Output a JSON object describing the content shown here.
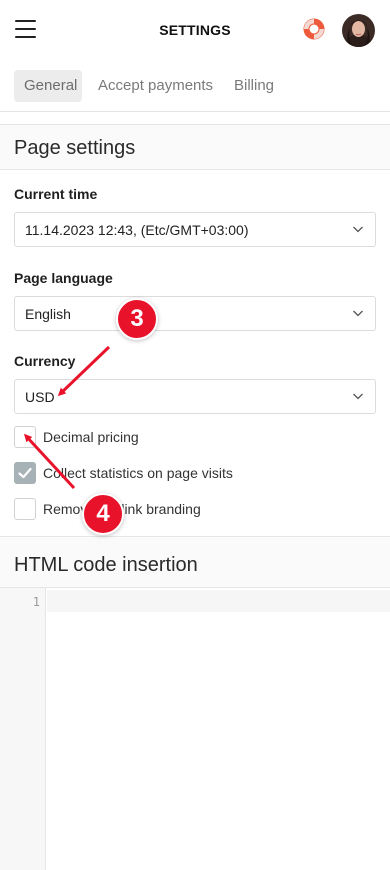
{
  "header": {
    "title": "SETTINGS",
    "menu_icon": "hamburger-menu-icon",
    "help_icon": "lifebuoy-icon",
    "avatar": "user-avatar"
  },
  "tabs": [
    {
      "label": "General",
      "active": true
    },
    {
      "label": "Accept payments",
      "active": false
    },
    {
      "label": "Billing",
      "active": false
    }
  ],
  "page_settings": {
    "title": "Page settings",
    "current_time": {
      "label": "Current time",
      "value": "11.14.2023 12:43, (Etc/GMT+03:00)"
    },
    "page_language": {
      "label": "Page language",
      "value": "English"
    },
    "currency": {
      "label": "Currency",
      "value": "USD"
    },
    "checkboxes": [
      {
        "label": "Decimal pricing",
        "checked": false
      },
      {
        "label": "Collect statistics on page visits",
        "checked": true
      },
      {
        "label": "Remove Taplink branding",
        "checked": false
      }
    ]
  },
  "html_code": {
    "title": "HTML code insertion",
    "line_numbers": [
      "1"
    ]
  },
  "annotations": [
    {
      "number": "3"
    },
    {
      "number": "4"
    }
  ],
  "colors": {
    "accent_red": "#e8132b",
    "checkbox_checked": "#a7b2b7"
  }
}
